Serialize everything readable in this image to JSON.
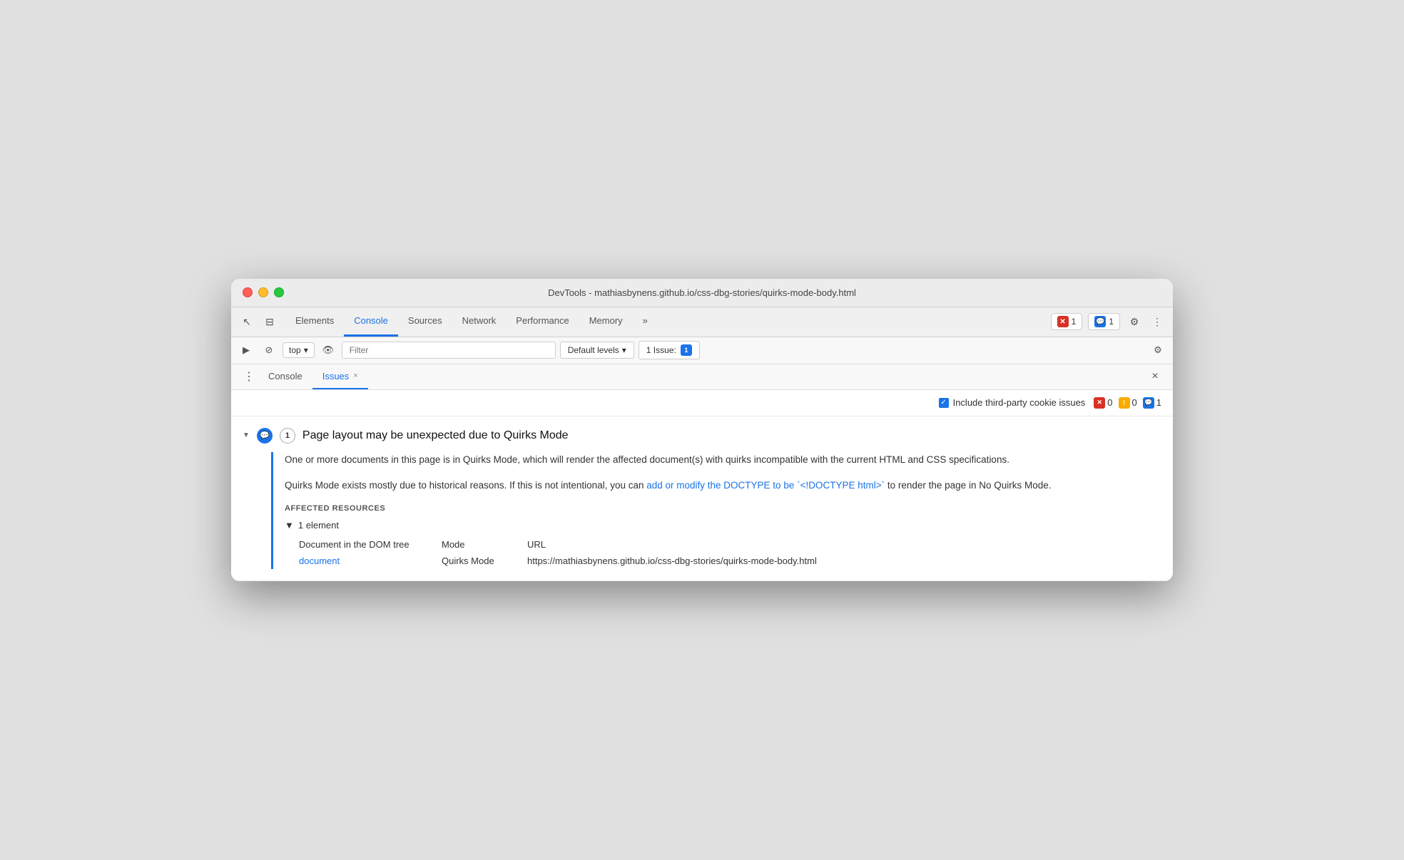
{
  "window": {
    "title": "DevTools - mathiasbynens.github.io/css-dbg-stories/quirks-mode-body.html"
  },
  "toolbar": {
    "tabs": [
      {
        "id": "elements",
        "label": "Elements",
        "active": false
      },
      {
        "id": "console",
        "label": "Console",
        "active": true
      },
      {
        "id": "sources",
        "label": "Sources",
        "active": false
      },
      {
        "id": "network",
        "label": "Network",
        "active": false
      },
      {
        "id": "performance",
        "label": "Performance",
        "active": false
      },
      {
        "id": "memory",
        "label": "Memory",
        "active": false
      },
      {
        "id": "more",
        "label": "»",
        "active": false
      }
    ],
    "error_count": "1",
    "message_count": "1"
  },
  "secondary_toolbar": {
    "top_selector": "top",
    "filter_placeholder": "Filter",
    "levels_label": "Default levels",
    "issues_label": "1 Issue:",
    "issues_count": "1"
  },
  "panel": {
    "tabs": [
      {
        "id": "console-tab",
        "label": "Console",
        "active": false,
        "closeable": false
      },
      {
        "id": "issues-tab",
        "label": "Issues",
        "active": true,
        "closeable": true
      }
    ]
  },
  "issues": {
    "include_third_party": "Include third-party cookie issues",
    "error_count": "0",
    "warn_count": "0",
    "info_count": "1",
    "items": [
      {
        "id": "quirks-mode",
        "count": "1",
        "title": "Page layout may be unexpected due to Quirks Mode",
        "description1": "One or more documents in this page is in Quirks Mode, which will render the affected document(s) with quirks incompatible with the current HTML and CSS specifications.",
        "description2_pre": "Quirks Mode exists mostly due to historical reasons. If this is not intentional, you can ",
        "description2_link": "add or modify the DOCTYPE to be `<!DOCTYPE html>`",
        "description2_post": " to render the page in No Quirks Mode.",
        "affected_resources_label": "AFFECTED RESOURCES",
        "element_count_label": "1 element",
        "col_doc": "Document in the DOM tree",
        "col_mode": "Mode",
        "col_url": "URL",
        "resource_link": "document",
        "resource_mode": "Quirks Mode",
        "resource_url": "https://mathiasbynens.github.io/css-dbg-stories/quirks-mode-body.html"
      }
    ]
  }
}
